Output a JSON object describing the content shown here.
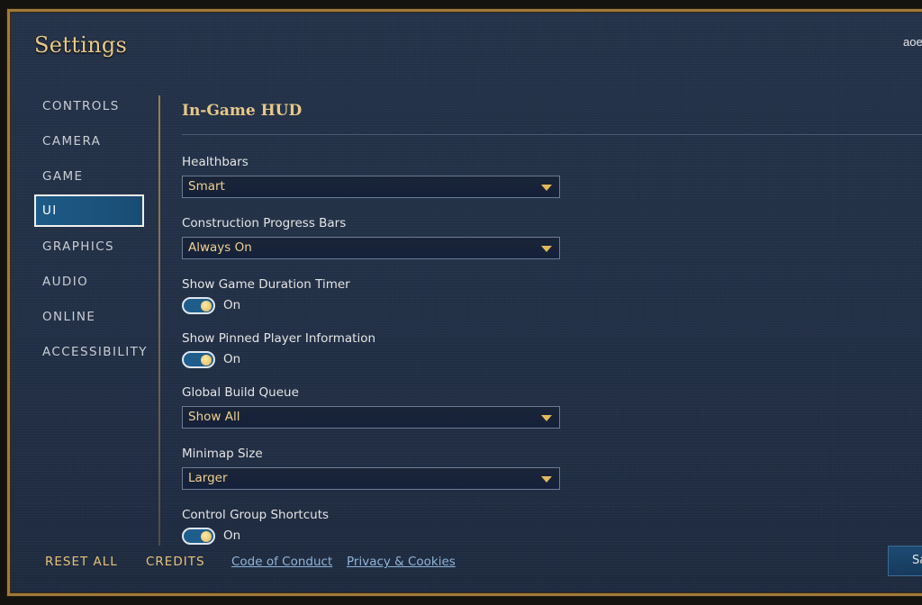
{
  "header": {
    "title": "Settings",
    "username": "aoe"
  },
  "nav": {
    "items": [
      {
        "label": "CONTROLS"
      },
      {
        "label": "CAMERA"
      },
      {
        "label": "GAME"
      },
      {
        "label": "UI",
        "active": true
      },
      {
        "label": "GRAPHICS"
      },
      {
        "label": "AUDIO"
      },
      {
        "label": "ONLINE"
      },
      {
        "label": "ACCESSIBILITY"
      }
    ]
  },
  "section": {
    "title": "In-Game HUD"
  },
  "settings": {
    "healthbars": {
      "label": "Healthbars",
      "value": "Smart"
    },
    "construction": {
      "label": "Construction Progress Bars",
      "value": "Always On"
    },
    "duration_timer": {
      "label": "Show Game Duration Timer",
      "state": "On"
    },
    "pinned_player": {
      "label": "Show Pinned Player Information",
      "state": "On"
    },
    "build_queue": {
      "label": "Global Build Queue",
      "value": "Show All"
    },
    "minimap": {
      "label": "Minimap Size",
      "value": "Larger"
    },
    "control_group": {
      "label": "Control Group Shortcuts",
      "state": "On"
    }
  },
  "footer": {
    "reset_all": "RESET ALL",
    "credits": "CREDITS",
    "code_of_conduct": "Code of Conduct",
    "privacy": "Privacy & Cookies",
    "save": "Sa"
  },
  "colors": {
    "accent_gold": "#e8c887",
    "active_blue": "#1d5b88",
    "link_blue": "#8fb4d8"
  }
}
